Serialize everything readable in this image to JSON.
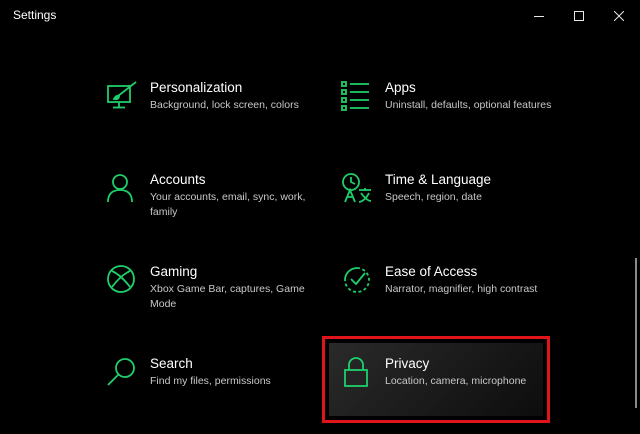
{
  "window": {
    "title": "Settings",
    "controls": {
      "minimize": "minimize",
      "maximize": "maximize",
      "close": "close"
    }
  },
  "accent": "#1fcf6b",
  "tiles": [
    {
      "name": "Personalization",
      "desc": "Background, lock screen, colors",
      "icon": "personalization-icon"
    },
    {
      "name": "Apps",
      "desc": "Uninstall, defaults, optional features",
      "icon": "apps-icon"
    },
    {
      "name": "Accounts",
      "desc": "Your accounts, email, sync, work, family",
      "icon": "accounts-icon"
    },
    {
      "name": "Time & Language",
      "desc": "Speech, region, date",
      "icon": "time-language-icon"
    },
    {
      "name": "Gaming",
      "desc": "Xbox Game Bar, captures, Game Mode",
      "icon": "xbox-icon"
    },
    {
      "name": "Ease of Access",
      "desc": "Narrator, magnifier, high contrast",
      "icon": "ease-of-access-icon"
    },
    {
      "name": "Search",
      "desc": "Find my files, permissions",
      "icon": "search-icon"
    },
    {
      "name": "Privacy",
      "desc": "Location, camera, microphone",
      "icon": "lock-icon",
      "selected": true
    }
  ]
}
